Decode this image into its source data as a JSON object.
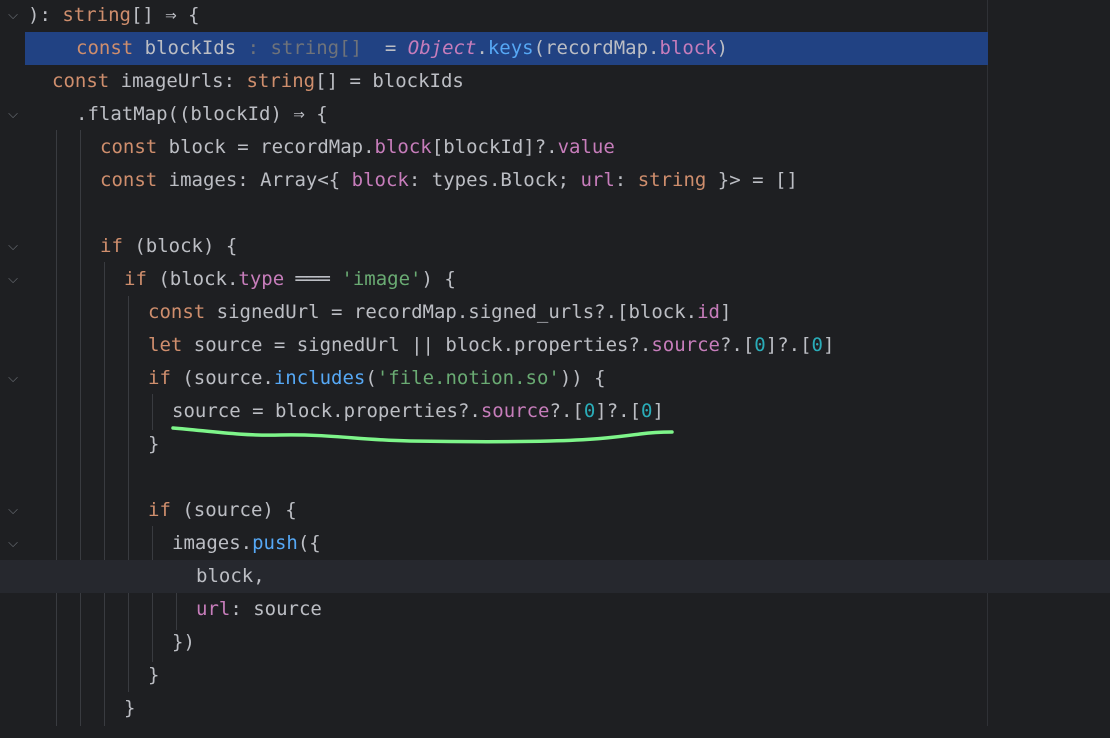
{
  "editor": {
    "language": "TypeScript",
    "theme_colors": {
      "background": "#1e1f22",
      "keyword": "#cf8e6d",
      "function": "#56a8f5",
      "property": "#c77dbb",
      "string": "#6aab73",
      "number": "#2aacb8",
      "text": "#bcbec4",
      "selection": "#214283",
      "annotation_stroke": "#7ef58a"
    },
    "lines": [
      {
        "tokens": [
          [
            "plain",
            "): "
          ],
          [
            "ty",
            "string"
          ],
          [
            "plain",
            "[] ⇒ {"
          ]
        ],
        "fold": "chevron-down-icon"
      },
      {
        "tokens": [
          [
            "kw",
            "const "
          ],
          [
            "plain",
            "blockIds"
          ],
          [
            "hint",
            " : string[] "
          ],
          [
            "plain",
            " = "
          ],
          [
            "cls",
            "Object"
          ],
          [
            "plain",
            "."
          ],
          [
            "fn",
            "keys"
          ],
          [
            "plain",
            "(recordMap."
          ],
          [
            "prop",
            "block"
          ],
          [
            "plain",
            ")"
          ]
        ],
        "fold": ""
      },
      {
        "tokens": [
          [
            "kw",
            "const "
          ],
          [
            "plain",
            "imageUrls: "
          ],
          [
            "ty",
            "string"
          ],
          [
            "plain",
            "[] = blockIds"
          ]
        ],
        "fold": ""
      },
      {
        "tokens": [
          [
            "plain",
            ".flatMap((blockId) ⇒ {"
          ]
        ],
        "fold": "chevron-down-icon"
      },
      {
        "tokens": [
          [
            "kw",
            "const "
          ],
          [
            "plain",
            "block = recordMap."
          ],
          [
            "prop",
            "block"
          ],
          [
            "plain",
            "[blockId]?."
          ],
          [
            "prop",
            "value"
          ]
        ],
        "fold": ""
      },
      {
        "tokens": [
          [
            "kw",
            "const "
          ],
          [
            "plain",
            "images: Array<{ "
          ],
          [
            "prop",
            "block"
          ],
          [
            "plain",
            ": types.Block; "
          ],
          [
            "prop",
            "url"
          ],
          [
            "plain",
            ": "
          ],
          [
            "ty",
            "string"
          ],
          [
            "plain",
            " }> = []"
          ]
        ],
        "fold": ""
      },
      {
        "tokens": [],
        "fold": ""
      },
      {
        "tokens": [
          [
            "kw",
            "if "
          ],
          [
            "plain",
            "(block) {"
          ]
        ],
        "fold": "chevron-down-icon"
      },
      {
        "tokens": [
          [
            "kw",
            "if "
          ],
          [
            "plain",
            "(block."
          ],
          [
            "prop",
            "type"
          ],
          [
            "plain",
            " ═══ "
          ],
          [
            "str",
            "'image'"
          ],
          [
            "plain",
            ") {"
          ]
        ],
        "fold": "chevron-down-icon"
      },
      {
        "tokens": [
          [
            "kw",
            "const "
          ],
          [
            "plain",
            "signedUrl = recordMap.signed_urls?.[block."
          ],
          [
            "prop",
            "id"
          ],
          [
            "plain",
            "]"
          ]
        ],
        "fold": ""
      },
      {
        "tokens": [
          [
            "kw",
            "let "
          ],
          [
            "plain",
            "source = signedUrl || block.properties?."
          ],
          [
            "prop",
            "source"
          ],
          [
            "plain",
            "?.["
          ],
          [
            "num",
            "0"
          ],
          [
            "plain",
            "]?.["
          ],
          [
            "num",
            "0"
          ],
          [
            "plain",
            "]"
          ]
        ],
        "fold": ""
      },
      {
        "tokens": [
          [
            "kw",
            "if "
          ],
          [
            "plain",
            "(source."
          ],
          [
            "fn",
            "includes"
          ],
          [
            "plain",
            "("
          ],
          [
            "str",
            "'file.notion.so'"
          ],
          [
            "plain",
            ")) {"
          ]
        ],
        "fold": "chevron-down-icon"
      },
      {
        "tokens": [
          [
            "plain",
            "source = block.properties?."
          ],
          [
            "prop",
            "source"
          ],
          [
            "plain",
            "?.["
          ],
          [
            "num",
            "0"
          ],
          [
            "plain",
            "]?.["
          ],
          [
            "num",
            "0"
          ],
          [
            "plain",
            "]"
          ]
        ],
        "fold": ""
      },
      {
        "tokens": [
          [
            "plain",
            "}"
          ]
        ],
        "fold": ""
      },
      {
        "tokens": [],
        "fold": ""
      },
      {
        "tokens": [
          [
            "kw",
            "if "
          ],
          [
            "plain",
            "(source) {"
          ]
        ],
        "fold": "chevron-down-icon"
      },
      {
        "tokens": [
          [
            "plain",
            "images."
          ],
          [
            "fn",
            "push"
          ],
          [
            "plain",
            "({"
          ]
        ],
        "fold": "chevron-down-icon"
      },
      {
        "tokens": [
          [
            "plain",
            "block,"
          ]
        ],
        "fold": ""
      },
      {
        "tokens": [
          [
            "prop",
            "url"
          ],
          [
            "plain",
            ": source"
          ]
        ],
        "fold": ""
      },
      {
        "tokens": [
          [
            "plain",
            "})"
          ]
        ],
        "fold": ""
      },
      {
        "tokens": [
          [
            "plain",
            "}"
          ]
        ],
        "fold": ""
      },
      {
        "tokens": [
          [
            "plain",
            "}"
          ]
        ],
        "fold": ""
      }
    ]
  }
}
